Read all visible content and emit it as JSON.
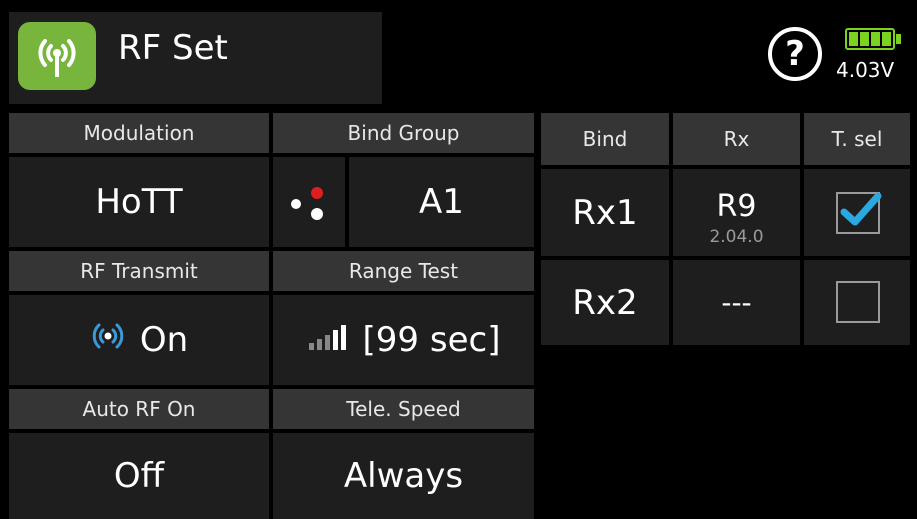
{
  "header": {
    "title": "RF Set",
    "help_symbol": "?",
    "voltage": "4.03V",
    "app_icon": "antenna-signal-icon",
    "battery_icon": "battery-full-icon",
    "battery_color": "#7bd21f",
    "accent_color": "#78b53c"
  },
  "settings": {
    "modulation": {
      "label": "Modulation",
      "value": "HoTT"
    },
    "bind_group": {
      "label": "Bind Group",
      "value": "A1",
      "icon": "bind-dots-icon"
    },
    "rf_transmit": {
      "label": "RF Transmit",
      "value": "On",
      "icon": "broadcast-icon"
    },
    "range_test": {
      "label": "Range Test",
      "value": "[99 sec]",
      "icon": "signal-bars-icon"
    },
    "auto_rf_on": {
      "label": "Auto RF On",
      "value": "Off"
    },
    "tele_speed": {
      "label": "Tele. Speed",
      "value": "Always"
    }
  },
  "receivers": {
    "columns": [
      "Bind",
      "Rx",
      "T. sel"
    ],
    "rows": [
      {
        "bind": "Rx1",
        "rx": "R9",
        "version": "2.04.0",
        "tsel": true
      },
      {
        "bind": "Rx2",
        "rx": "---",
        "version": "",
        "tsel": false
      }
    ],
    "check_color": "#2aa8e0"
  }
}
